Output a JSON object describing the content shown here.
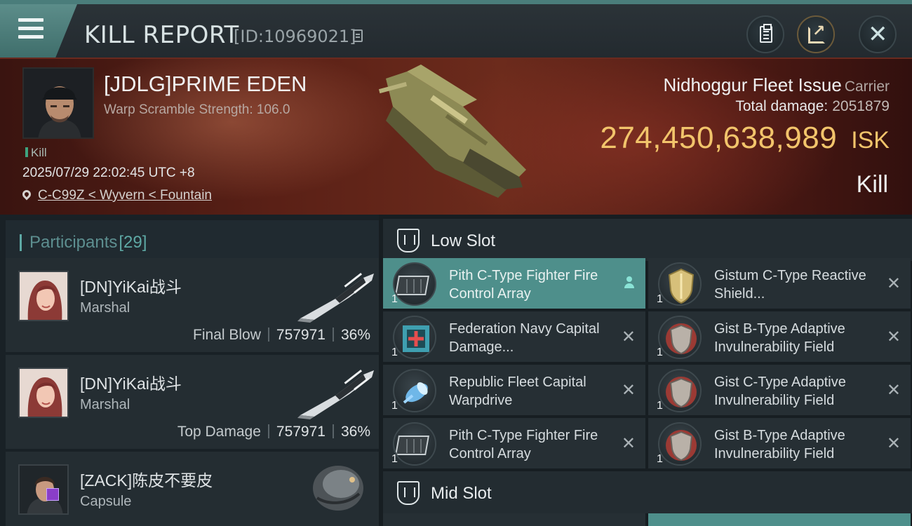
{
  "header": {
    "title": "KILL REPORT",
    "report_id": "[ID:10969021]"
  },
  "victim": {
    "name": "[JDLG]PRIME EDEN",
    "warp_scramble": "Warp Scramble Strength: 106.0",
    "tag": "Kill",
    "datetime": "2025/07/29 22:02:45 UTC +8",
    "location": "C-C99Z < Wyvern < Fountain",
    "ship_name": "Nidhoggur Fleet Issue",
    "ship_class": "Carrier",
    "total_damage_label": "Total damage:",
    "total_damage": "2051879",
    "isk_value": "274,450,638,989",
    "isk_unit": "ISK",
    "result": "Kill"
  },
  "participants": {
    "label": "Participants",
    "count": "[29]",
    "rows": [
      {
        "name": "[DN]YiKai战斗",
        "ship": "Marshal",
        "role": "Final Blow",
        "damage": "757971",
        "percent": "36%"
      },
      {
        "name": "[DN]YiKai战斗",
        "ship": "Marshal",
        "role": "Top Damage",
        "damage": "757971",
        "percent": "36%"
      },
      {
        "name": "[ZACK]陈皮不要皮",
        "ship": "Capsule"
      }
    ]
  },
  "fitting": {
    "low_slot": {
      "label": "Low Slot",
      "modules": [
        {
          "name": "Pith C-Type Fighter Fire Control Array",
          "qty": "1",
          "selected": true
        },
        {
          "name": "Gistum C-Type Reactive Shield...",
          "qty": "1"
        },
        {
          "name": "Federation Navy Capital Damage...",
          "qty": "1"
        },
        {
          "name": "Gist B-Type Adaptive Invulnerability Field",
          "qty": "1"
        },
        {
          "name": "Republic Fleet Capital Warpdrive",
          "qty": "1"
        },
        {
          "name": "Gist C-Type Adaptive Invulnerability Field",
          "qty": "1"
        },
        {
          "name": "Pith C-Type Fighter Fire Control Array",
          "qty": "1"
        },
        {
          "name": "Gist B-Type Adaptive Invulnerability Field",
          "qty": "1"
        }
      ]
    },
    "mid_slot": {
      "label": "Mid Slot"
    }
  },
  "colors": {
    "accent": "#5ea9a5",
    "isk": "#f2c46b",
    "selected_module": "#4e8f8b"
  }
}
